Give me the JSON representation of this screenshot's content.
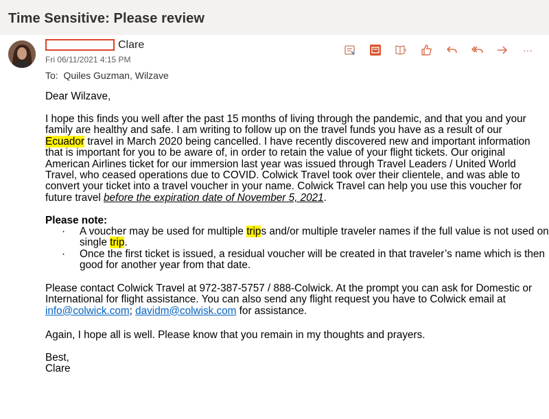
{
  "subject": "Time Sensitive: Please review",
  "sender": {
    "name": "Clare",
    "datetime": "Fri 06/11/2021 4:15 PM",
    "to_label": "To:",
    "to": "Quiles Guzman, Wilzave"
  },
  "toolbar": {
    "icons": [
      "sensitivity-icon",
      "teams-icon",
      "immersive-reader-icon",
      "like-icon",
      "reply-icon",
      "reply-all-icon",
      "forward-icon",
      "more-icon"
    ],
    "more_label": "···"
  },
  "body": {
    "greeting": "Dear Wilzave,",
    "p1_a": "I hope this finds you well after the past 15 months of living through the pandemic, and that you and your family are healthy and safe. I am writing to follow up on the travel funds you have as a result of our ",
    "p1_hl": "Ecuador",
    "p1_b": " travel in March 2020 being cancelled. I have recently discovered new and important information that is important for you to be aware of, in order to retain the value of your flight tickets. Our original American Airlines ticket for our immersion last year was issued through Travel Leaders / United World Travel, who ceased operations due to COVID. Colwick Travel took over their clientele, and was able to convert your ticket into a travel voucher in your name.  Colwick Travel can help you use this voucher for future travel ",
    "p1_u": "before the expiration date of November 5, 2021",
    "p1_end": ".",
    "note_heading": "Please note:",
    "bullet_marker": "·",
    "b1_a": "A voucher may be used for multiple ",
    "b1_hl1": "trip",
    "b1_b": "s and/or multiple traveler names if the full value is not used on a single ",
    "b1_hl2": "trip",
    "b1_c": ".",
    "b2": "Once the first ticket is issued, a residual voucher will be created in that traveler’s name which is then good for another year from that date.",
    "p2": "Please contact Colwick Travel at 972-387-5757 / 888-Colwick. At the prompt you can ask for Domestic or International for flight assistance. You can also send any flight request you have to Colwick email at ",
    "link1": "info@colwick.com",
    "sep": "; ",
    "link2": "davidm@colwisk.com",
    "p2_end": " for assistance.",
    "p3": "Again, I hope all is well. Please know that you remain in my thoughts and prayers.",
    "closing": "Best,",
    "signature": "Clare"
  }
}
